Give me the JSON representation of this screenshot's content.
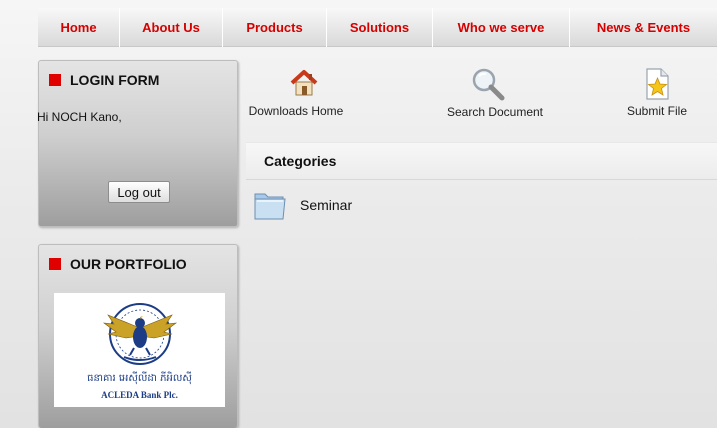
{
  "nav": {
    "items": [
      {
        "label": "Home"
      },
      {
        "label": "About Us"
      },
      {
        "label": "Products"
      },
      {
        "label": "Solutions"
      },
      {
        "label": "Who we serve"
      },
      {
        "label": "News & Events"
      }
    ]
  },
  "login_box": {
    "title": "LOGIN FORM",
    "greeting": "Hi NOCH Kano,",
    "logout_label": "Log out"
  },
  "portfolio_box": {
    "title": "OUR PORTFOLIO",
    "logo": {
      "khmer_name": "ធនាគារ អេស៊ីលីដា ភីអិលស៊ី",
      "english_name": "ACLEDA Bank Plc."
    }
  },
  "toolbar": {
    "downloads_home": "Downloads Home",
    "search_document": "Search Document",
    "submit_file": "Submit File"
  },
  "categories": {
    "title": "Categories",
    "items": [
      {
        "label": "Seminar"
      }
    ]
  },
  "colors": {
    "nav_text": "#d50000",
    "title_square": "#e00000"
  }
}
